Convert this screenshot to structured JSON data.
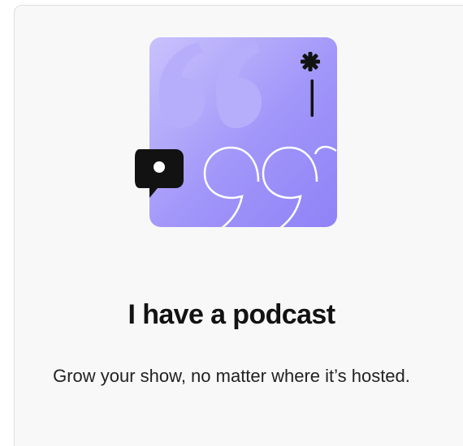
{
  "card": {
    "title": "I have a podcast",
    "description": "Grow your show, no matter where it’s hosted.",
    "illustration": {
      "icons": [
        "quote-open-icon",
        "quote-close-icon",
        "chat-bubble-icon",
        "gear-icon"
      ]
    }
  },
  "colors": {
    "card_background": "#f8f8f8",
    "card_border": "#dedede",
    "illustration_base": "#9b8ef8",
    "illustration_light": "#c5bdfb",
    "quote_fill": "#b0a6fa",
    "bubble": "#121212",
    "title_text": "#121212",
    "body_text": "#222222"
  }
}
